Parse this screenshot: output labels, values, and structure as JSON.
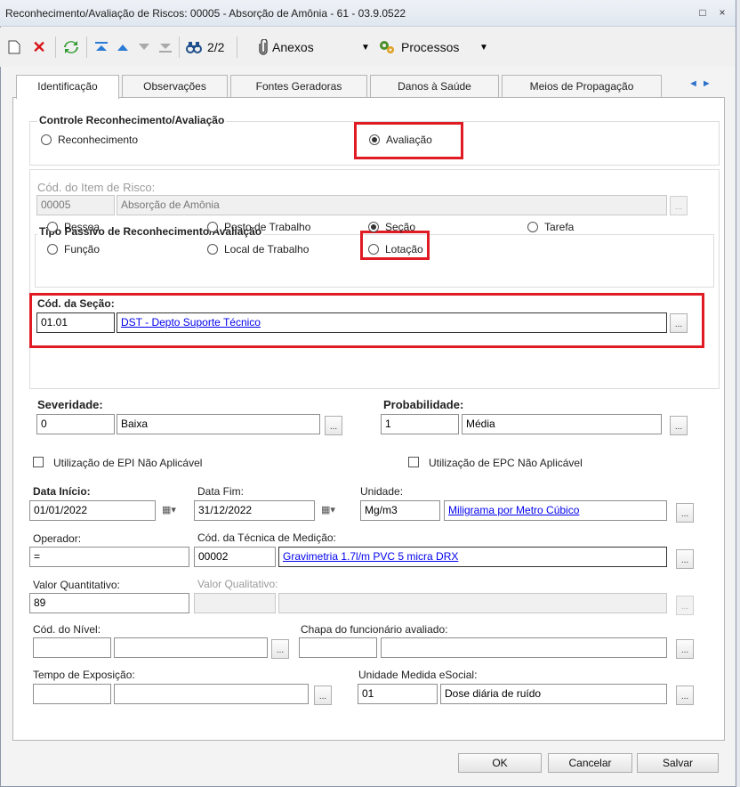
{
  "window": {
    "title": "Reconhecimento/Avaliação de Riscos: 00005 - Absorção de Amônia - 61 - 03.9.0522",
    "restore_glyph": "□",
    "close_glyph": "×"
  },
  "toolbar": {
    "record_counter": "2/2",
    "attachments_label": "Anexos",
    "processes_label": "Processos",
    "icons": [
      "new-document-icon",
      "delete-icon",
      "refresh-icon",
      "first-record-icon",
      "previous-record-icon",
      "next-record-icon",
      "last-record-icon",
      "find-icon",
      "attachment-icon",
      "processes-icon"
    ]
  },
  "tabs": [
    "Identificação",
    "Observações",
    "Fontes Geradoras",
    "Danos à Saúde",
    "Meios de Propagação"
  ],
  "controle": {
    "title": "Controle Reconhecimento/Avaliação",
    "options": [
      "Reconhecimento",
      "Avaliação"
    ],
    "selected": "Avaliação"
  },
  "item_risco": {
    "label": "Cód. do Item de Risco:",
    "code": "00005",
    "description": "Absorção de Amônia"
  },
  "tipo_passivo": {
    "title": "Tipo Passivo de Reconhecimento/Avaliação",
    "options": [
      "Pessoa",
      "Posto de Trabalho",
      "Seção",
      "Tarefa",
      "Função",
      "Local de Trabalho",
      "Lotação"
    ],
    "selected": "Seção"
  },
  "secao": {
    "label": "Cód. da Seção:",
    "code": "01.01",
    "description": "DST - Depto Suporte Técnico"
  },
  "severidade": {
    "label": "Severidade:",
    "code": "0",
    "description": "Baixa"
  },
  "probabilidade": {
    "label": "Probabilidade:",
    "code": "1",
    "description": "Média"
  },
  "epi": {
    "label": "Utilização de EPI Não Aplicável",
    "checked": false
  },
  "epc": {
    "label": "Utilização de EPC Não Aplicável",
    "checked": false
  },
  "data_inicio": {
    "label": "Data Início:",
    "value": "01/01/2022"
  },
  "data_fim": {
    "label": "Data Fim:",
    "value": "31/12/2022"
  },
  "unidade": {
    "label": "Unidade:",
    "code": "Mg/m3",
    "description": "Miligrama por Metro Cúbico"
  },
  "operador": {
    "label": "Operador:",
    "value": "="
  },
  "tecnica": {
    "label": "Cód. da Técnica de Medição:",
    "code": "00002",
    "description": "Gravimetria 1.7l/m PVC 5 micra DRX"
  },
  "valor_quantitativo": {
    "label": "Valor Quantitativo:",
    "value": "89"
  },
  "valor_qualitativo": {
    "label": "Valor Qualitativo:",
    "code": "",
    "description": ""
  },
  "nivel": {
    "label": "Cód. do Nível:",
    "code": "",
    "description": ""
  },
  "chapa": {
    "label": "Chapa do funcionário avaliado:",
    "code": "",
    "description": ""
  },
  "tempo_exposicao": {
    "label": "Tempo de Exposição:",
    "code": "",
    "description": ""
  },
  "unidade_esocial": {
    "label": "Unidade Medida eSocial:",
    "code": "01",
    "description": "Dose diária de ruído"
  },
  "buttons": {
    "ok": "OK",
    "cancel": "Cancelar",
    "save": "Salvar"
  },
  "dots_label": "...",
  "colors": {
    "highlight": "#e01b24",
    "link": "#0000ee"
  }
}
